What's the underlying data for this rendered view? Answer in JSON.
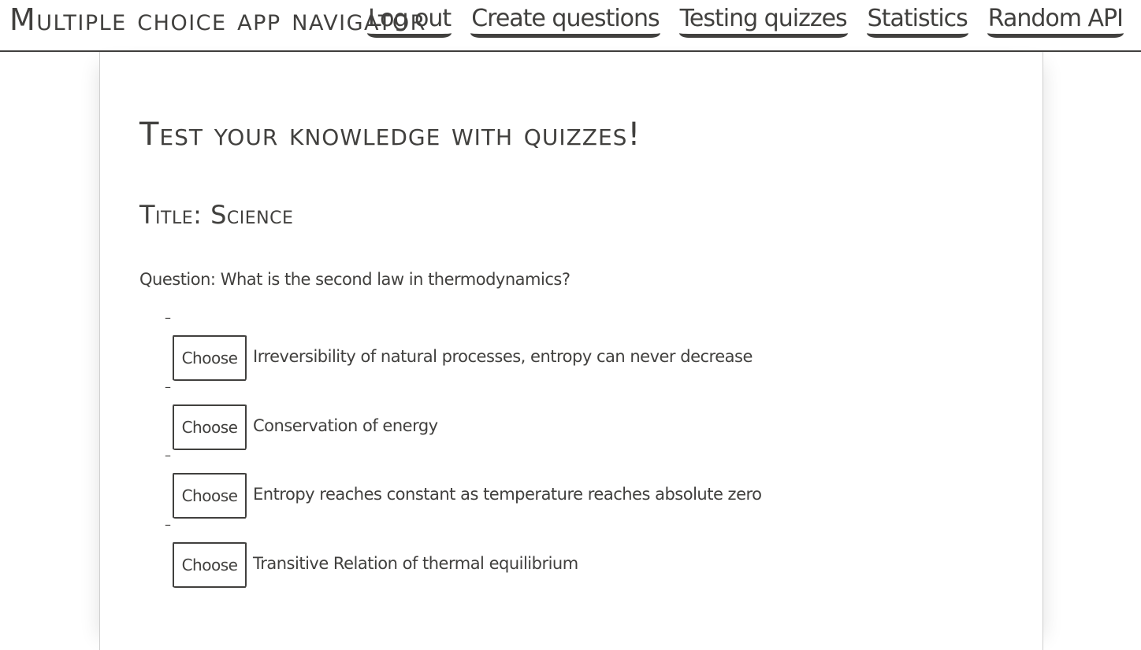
{
  "navbar": {
    "brand": "Multiple choice app navigator",
    "links": [
      {
        "label": "Log out"
      },
      {
        "label": "Create questions"
      },
      {
        "label": "Testing quizzes"
      },
      {
        "label": "Statistics"
      },
      {
        "label": "Random API"
      }
    ]
  },
  "main": {
    "page_title": "Test your knowledge with quizzes!",
    "quiz_title_prefix": "Title: ",
    "quiz_title": "Science",
    "question_prefix": "Question: ",
    "question": "What is the second law in thermodynamics?",
    "option_marker": "–",
    "choose_label": "Choose",
    "options": [
      {
        "text": "Irreversibility of natural processes, entropy can never decrease"
      },
      {
        "text": "Conservation of energy"
      },
      {
        "text": "Entropy reaches constant as temperature reaches absolute zero"
      },
      {
        "text": "Transitive Relation of thermal equilibrium"
      }
    ]
  }
}
